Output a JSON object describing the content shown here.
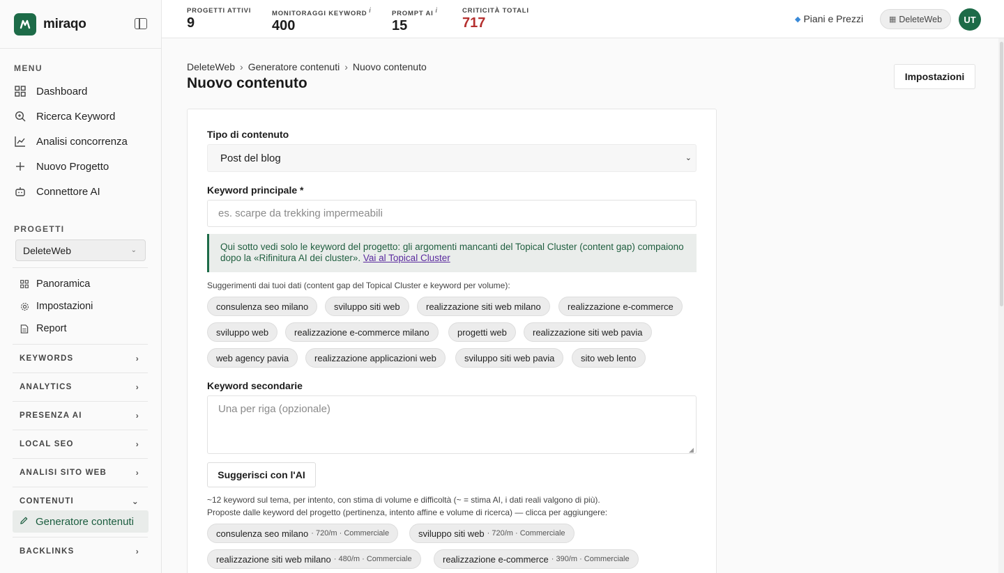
{
  "brand": {
    "name": "miraqo"
  },
  "sidebar": {
    "menu_label": "MENU",
    "menu_items": [
      "Dashboard",
      "Ricerca Keyword",
      "Analisi concorrenza",
      "Nuovo Progetto",
      "Connettore AI"
    ],
    "projects_label": "PROGETTI",
    "project_selected": "DeleteWeb",
    "project_items": [
      "Panoramica",
      "Impostazioni",
      "Report"
    ],
    "groups": [
      "KEYWORDS",
      "ANALYTICS",
      "PRESENZA AI",
      "LOCAL SEO",
      "ANALISI SITO WEB",
      "CONTENUTI",
      "BACKLINKS"
    ],
    "active_item": "Generatore contenuti"
  },
  "topbar": {
    "stats": [
      {
        "label": "PROGETTI ATTIVI",
        "value": "9"
      },
      {
        "label": "MONITORAGGI KEYWORD",
        "value": "400"
      },
      {
        "label": "PROMPT AI",
        "value": "15"
      },
      {
        "label": "CRITICITÀ TOTALI",
        "value": "717"
      }
    ],
    "info_mark": "i",
    "plans_label": "Piani e Prezzi",
    "workspace_label": "DeleteWeb",
    "avatar_initials": "UT"
  },
  "page": {
    "breadcrumb": [
      "DeleteWeb",
      "Generatore contenuti",
      "Nuovo contenuto"
    ],
    "title": "Nuovo contenuto",
    "settings_button": "Impostazioni"
  },
  "form": {
    "content_type_label": "Tipo di contenuto",
    "content_type_value": "Post del blog",
    "main_keyword_label": "Keyword principale *",
    "main_keyword_placeholder": "es. scarpe da trekking impermeabili",
    "info_text": "Qui sotto vedi solo le keyword del progetto: gli argomenti mancanti del Topical Cluster (content gap) compaiono dopo la «Rifinitura AI dei cluster».",
    "info_link": "Vai al Topical Cluster",
    "suggestions_hint": "Suggerimenti dai tuoi dati (content gap del Topical Cluster e keyword per volume):",
    "suggestion_chips": [
      "consulenza seo milano",
      "sviluppo siti web",
      "realizzazione siti web milano",
      "realizzazione e-commerce",
      "sviluppo web",
      "realizzazione e-commerce milano",
      "progetti web",
      "realizzazione siti web pavia",
      "web agency pavia",
      "realizzazione applicazioni web",
      "sviluppo siti web pavia",
      "sito web lento"
    ],
    "secondary_label": "Keyword secondarie",
    "secondary_placeholder": "Una per riga (opzionale)",
    "ai_button": "Suggerisci con l'AI",
    "ai_hint_1": "~12 keyword sul tema, per intento, con stima di volume e difficoltà (~ = stima AI, i dati reali valgono di più).",
    "ai_hint_2": "Proposte dalle keyword del progetto (pertinenza, intento affine e volume di ricerca) — clicca per aggiungere:",
    "proposal_chips": [
      {
        "keyword": "consulenza seo milano",
        "meta": "· 720/m · Commerciale"
      },
      {
        "keyword": "sviluppo siti web",
        "meta": "· 720/m · Commerciale"
      },
      {
        "keyword": "realizzazione siti web milano",
        "meta": "· 480/m · Commerciale"
      },
      {
        "keyword": "realizzazione e-commerce",
        "meta": "· 390/m · Commerciale"
      }
    ]
  },
  "colors": {
    "brand_green": "#1d6b48",
    "critical_red": "#b5302f"
  }
}
